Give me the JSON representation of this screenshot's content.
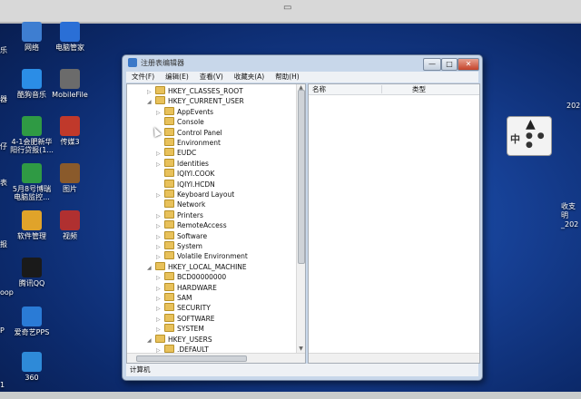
{
  "desktop": {
    "icons": [
      {
        "label": "网络",
        "color": "#3e7ed1"
      },
      {
        "label": "电脑管家",
        "color": "#2a6fd6"
      },
      {
        "label": "酷狗音乐",
        "color": "#2b8de6"
      },
      {
        "label": "MobileFile",
        "color": "#6b6b6b"
      },
      {
        "label": "4-1会肥新华\n阳行贷报(1...",
        "color": "#2f9a44"
      },
      {
        "label": "传媒3",
        "color": "#c0392b"
      },
      {
        "label": "5月8号博瑞\n电脑监控...",
        "color": "#2f9a44"
      },
      {
        "label": "图片",
        "color": "#8a5a2b"
      },
      {
        "label": "软件管理",
        "color": "#e0a32a"
      },
      {
        "label": "视频",
        "color": "#b03030"
      },
      {
        "label": "腾讯QQ",
        "color": "#1a1a1a"
      },
      {
        "label": "爱奇艺PPS",
        "color": "#2a7bd6"
      },
      {
        "label": "360",
        "color": "#2e8ad8"
      }
    ],
    "left_edge_labels": [
      "乐",
      "器",
      "仔",
      "表",
      "报",
      "oop",
      "P",
      "1"
    ],
    "right_edge_labels": [
      "202",
      "收支",
      "明_202"
    ],
    "ime": {
      "zh": "中",
      "dots": "● ● ●"
    }
  },
  "window": {
    "title": "注册表编辑器",
    "buttons": {
      "minimize": "—",
      "maximize": "□",
      "close": "✕"
    },
    "menu": [
      "文件(F)",
      "编辑(E)",
      "查看(V)",
      "收藏夹(A)",
      "帮助(H)"
    ],
    "tree": [
      {
        "label": "HKEY_CLASSES_ROOT",
        "level": 0,
        "exp": "▷"
      },
      {
        "label": "HKEY_CURRENT_USER",
        "level": 0,
        "exp": "◢"
      },
      {
        "label": "AppEvents",
        "level": 1,
        "exp": "▷"
      },
      {
        "label": "Console",
        "level": 1,
        "exp": ""
      },
      {
        "label": "Control Panel",
        "level": 1,
        "exp": "▷"
      },
      {
        "label": "Environment",
        "level": 1,
        "exp": ""
      },
      {
        "label": "EUDC",
        "level": 1,
        "exp": "▷"
      },
      {
        "label": "Identities",
        "level": 1,
        "exp": "▷"
      },
      {
        "label": "IQIYI.COOK",
        "level": 1,
        "exp": ""
      },
      {
        "label": "IQIYI.HCDN",
        "level": 1,
        "exp": ""
      },
      {
        "label": "Keyboard Layout",
        "level": 1,
        "exp": "▷"
      },
      {
        "label": "Network",
        "level": 1,
        "exp": ""
      },
      {
        "label": "Printers",
        "level": 1,
        "exp": "▷"
      },
      {
        "label": "RemoteAccess",
        "level": 1,
        "exp": "▷"
      },
      {
        "label": "Software",
        "level": 1,
        "exp": "▷"
      },
      {
        "label": "System",
        "level": 1,
        "exp": "▷"
      },
      {
        "label": "Volatile Environment",
        "level": 1,
        "exp": "▷"
      },
      {
        "label": "HKEY_LOCAL_MACHINE",
        "level": 0,
        "exp": "◢"
      },
      {
        "label": "BCD00000000",
        "level": 1,
        "exp": "▷"
      },
      {
        "label": "HARDWARE",
        "level": 1,
        "exp": "▷"
      },
      {
        "label": "SAM",
        "level": 1,
        "exp": "▷"
      },
      {
        "label": "SECURITY",
        "level": 1,
        "exp": "▷"
      },
      {
        "label": "SOFTWARE",
        "level": 1,
        "exp": "▷"
      },
      {
        "label": "SYSTEM",
        "level": 1,
        "exp": "▷"
      },
      {
        "label": "HKEY_USERS",
        "level": 0,
        "exp": "◢"
      },
      {
        "label": ".DEFAULT",
        "level": 1,
        "exp": "▷"
      }
    ],
    "list_headers": {
      "name": "名称",
      "type": "类型"
    },
    "status": "计算机"
  }
}
